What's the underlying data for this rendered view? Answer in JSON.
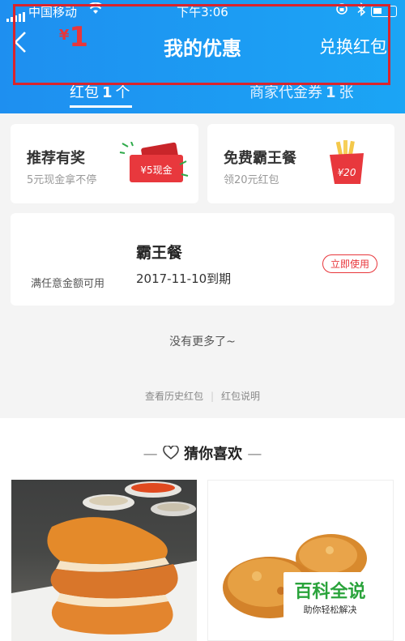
{
  "status_bar": {
    "carrier": "中国移动",
    "time": "下午3:06"
  },
  "nav": {
    "back_icon": "chevron-left-icon",
    "title": "我的优惠",
    "exchange_label": "兑换红包"
  },
  "tabs": [
    {
      "label": "红包",
      "count": "1",
      "unit": "个",
      "active": true
    },
    {
      "label": "商家代金券",
      "count": "1",
      "unit": "张",
      "active": false
    }
  ],
  "promos": [
    {
      "title": "推荐有奖",
      "subtitle": "5元现金拿不停",
      "badge": "¥5现金"
    },
    {
      "title": "免费霸王餐",
      "subtitle": "领20元红包",
      "badge": "¥20"
    }
  ],
  "coupon": {
    "currency": "¥",
    "amount": "1",
    "condition": "满任意金额可用",
    "name": "霸王餐",
    "expiry": "2017-11-10到期",
    "action_label": "立即使用"
  },
  "no_more_text": "没有更多了~",
  "links": {
    "history": "查看历史红包",
    "separator": "|",
    "rules": "红包说明"
  },
  "recommend": {
    "dash_left": "—",
    "title": "猜你喜欢",
    "dash_right": "—"
  },
  "watermark": {
    "title": "百科全说",
    "subtitle": "助你轻松解决"
  },
  "colors": {
    "header": "#1e8ff0",
    "accent_red": "#e8363b",
    "highlight_border": "#d9242c",
    "watermark_green": "#2aa33b"
  }
}
